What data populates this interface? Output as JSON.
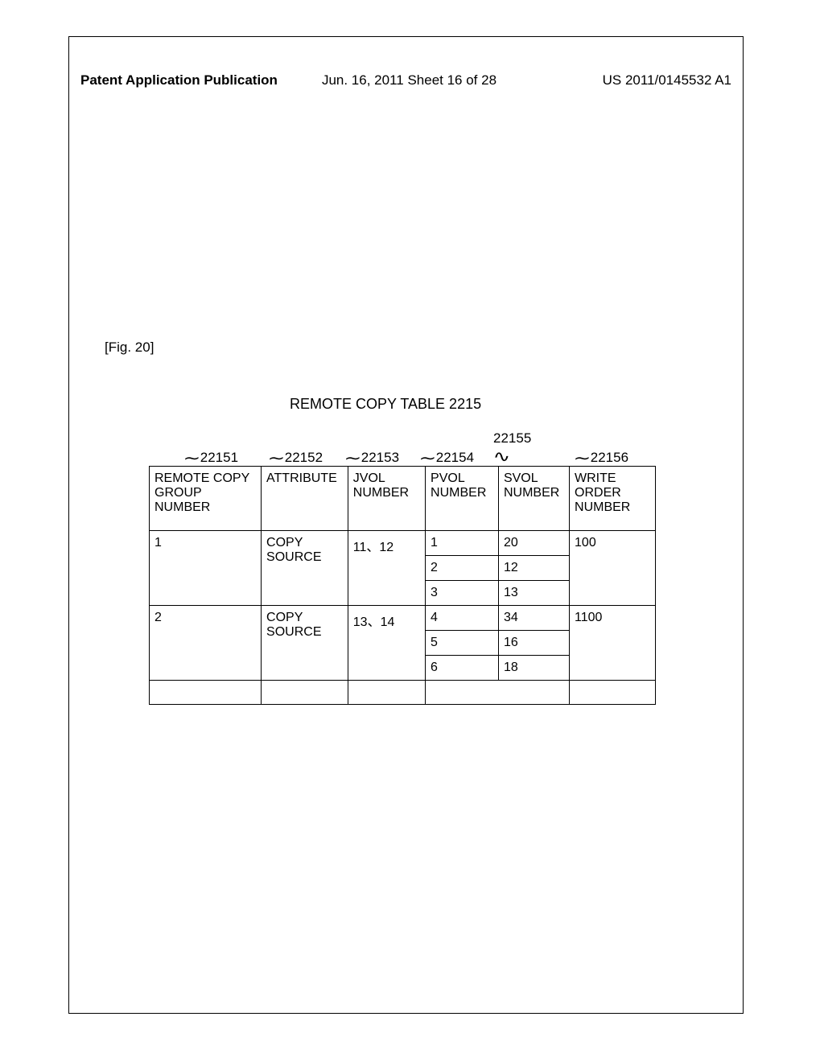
{
  "header": {
    "left": "Patent Application Publication",
    "center": "Jun. 16, 2011  Sheet 16 of 28",
    "right": "US 2011/0145532 A1"
  },
  "fig_label": "[Fig. 20]",
  "table_title": "REMOTE COPY TABLE  2215",
  "column_refs": {
    "c1": "22151",
    "c2": "22152",
    "c3": "22153",
    "c4": "22154",
    "c5": "22155",
    "c6": "22156"
  },
  "columns": {
    "h1": "REMOTE COPY GROUP NUMBER",
    "h2": "ATTRIBUTE",
    "h3": "JVOL NUMBER",
    "h4": "PVOL NUMBER",
    "h5": "SVOL NUMBER",
    "h6": "WRITE ORDER NUMBER"
  },
  "rows": [
    {
      "group": "1",
      "attr": "COPY SOURCE",
      "jvol": "11、12",
      "pvol": "1",
      "svol": "20",
      "won": "100"
    },
    {
      "pvol": "2",
      "svol": "12"
    },
    {
      "pvol": "3",
      "svol": "13"
    },
    {
      "group": "2",
      "attr": "COPY SOURCE",
      "jvol": "13、14",
      "pvol": "4",
      "svol": "34",
      "won": "1100"
    },
    {
      "pvol": "5",
      "svol": "16"
    },
    {
      "pvol": "6",
      "svol": "18"
    }
  ],
  "chart_data": {
    "type": "table",
    "title": "REMOTE COPY TABLE 2215",
    "columns": [
      "REMOTE COPY GROUP NUMBER",
      "ATTRIBUTE",
      "JVOL NUMBER",
      "PVOL NUMBER",
      "SVOL NUMBER",
      "WRITE ORDER NUMBER"
    ],
    "column_refs": [
      "22151",
      "22152",
      "22153",
      "22154",
      "22155",
      "22156"
    ],
    "data": [
      [
        "1",
        "COPY SOURCE",
        "11, 12",
        "1",
        "20",
        "100"
      ],
      [
        "",
        "",
        "",
        "2",
        "12",
        ""
      ],
      [
        "",
        "",
        "",
        "3",
        "13",
        ""
      ],
      [
        "2",
        "COPY SOURCE",
        "13, 14",
        "4",
        "34",
        "1100"
      ],
      [
        "",
        "",
        "",
        "5",
        "16",
        ""
      ],
      [
        "",
        "",
        "",
        "6",
        "18",
        ""
      ]
    ]
  }
}
